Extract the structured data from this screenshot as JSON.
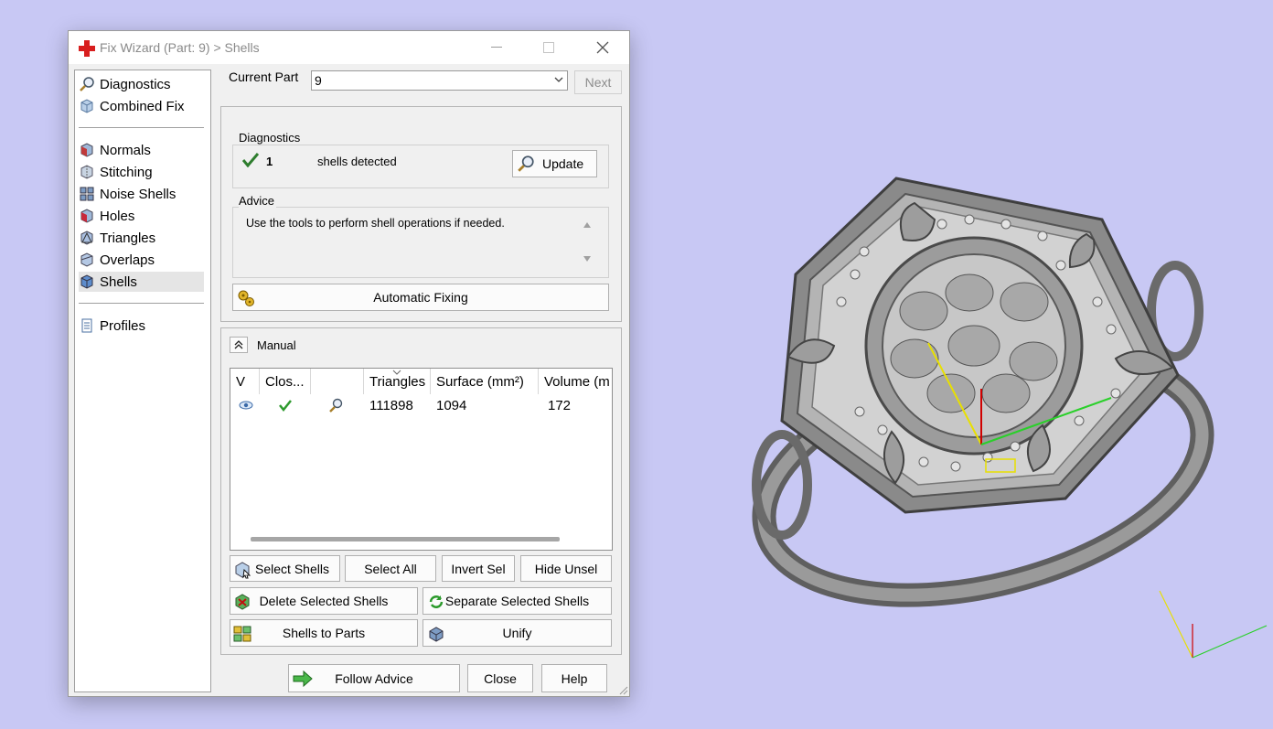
{
  "window": {
    "title": "Fix Wizard (Part: 9) > Shells"
  },
  "nav": {
    "items": [
      {
        "label": "Diagnostics",
        "icon": "magnifier-icon"
      },
      {
        "label": "Combined Fix",
        "icon": "cube-icon"
      },
      {
        "label": "Normals",
        "icon": "normals-icon"
      },
      {
        "label": "Stitching",
        "icon": "stitching-icon"
      },
      {
        "label": "Noise Shells",
        "icon": "noise-shells-icon"
      },
      {
        "label": "Holes",
        "icon": "holes-icon"
      },
      {
        "label": "Triangles",
        "icon": "triangles-icon"
      },
      {
        "label": "Overlaps",
        "icon": "overlaps-icon"
      },
      {
        "label": "Shells",
        "icon": "shells-icon",
        "selected": true
      },
      {
        "label": "Profiles",
        "icon": "document-icon"
      }
    ]
  },
  "current_part": {
    "label": "Current Part",
    "value": "9",
    "next_label": "Next"
  },
  "diagnostics": {
    "title": "Diagnostics",
    "count": "1",
    "status_text": "shells detected",
    "update_label": "Update"
  },
  "advice": {
    "title": "Advice",
    "text": "Use the tools to perform shell operations if needed."
  },
  "automatic_fixing_label": "Automatic Fixing",
  "manual": {
    "title": "Manual",
    "columns": [
      "V",
      "Clos...",
      "",
      "Triangles",
      "Surface (mm²)",
      "Volume (m"
    ],
    "rows": [
      {
        "triangles": "111898",
        "surface": "1094",
        "volume": "172"
      }
    ],
    "buttons": {
      "select_shells": "Select Shells",
      "select_all": "Select All",
      "invert_sel": "Invert Sel",
      "hide_unsel": "Hide Unsel",
      "delete_selected": "Delete Selected Shells",
      "separate_selected": "Separate Selected Shells",
      "shells_to_parts": "Shells to Parts",
      "unify": "Unify"
    }
  },
  "footer": {
    "follow_advice": "Follow Advice",
    "close": "Close",
    "help": "Help"
  },
  "colors": {
    "viewport_bg": "#c8c8f4",
    "accent_green": "#2e8b2e",
    "title_icon_red": "#d81e1e"
  }
}
